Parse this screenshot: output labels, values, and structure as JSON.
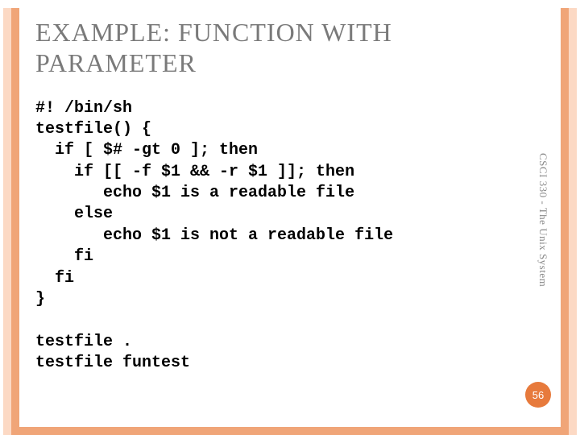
{
  "title": "EXAMPLE: FUNCTION WITH PARAMETER",
  "code_lines": [
    "#! /bin/sh",
    "testfile() {",
    "  if [ $# -gt 0 ]; then",
    "    if [[ -f $1 && -r $1 ]]; then",
    "       echo $1 is a readable file",
    "    else",
    "       echo $1 is not a readable file",
    "    fi",
    "  fi",
    "}",
    "",
    "testfile .",
    "testfile funtest"
  ],
  "side_label": "CSCI 330 - The Unix System",
  "page_number": "56",
  "colors": {
    "frame_outer": "#fcd9c4",
    "frame_inner": "#f0a578",
    "badge": "#e77a3c",
    "title": "#7a7a7a"
  }
}
